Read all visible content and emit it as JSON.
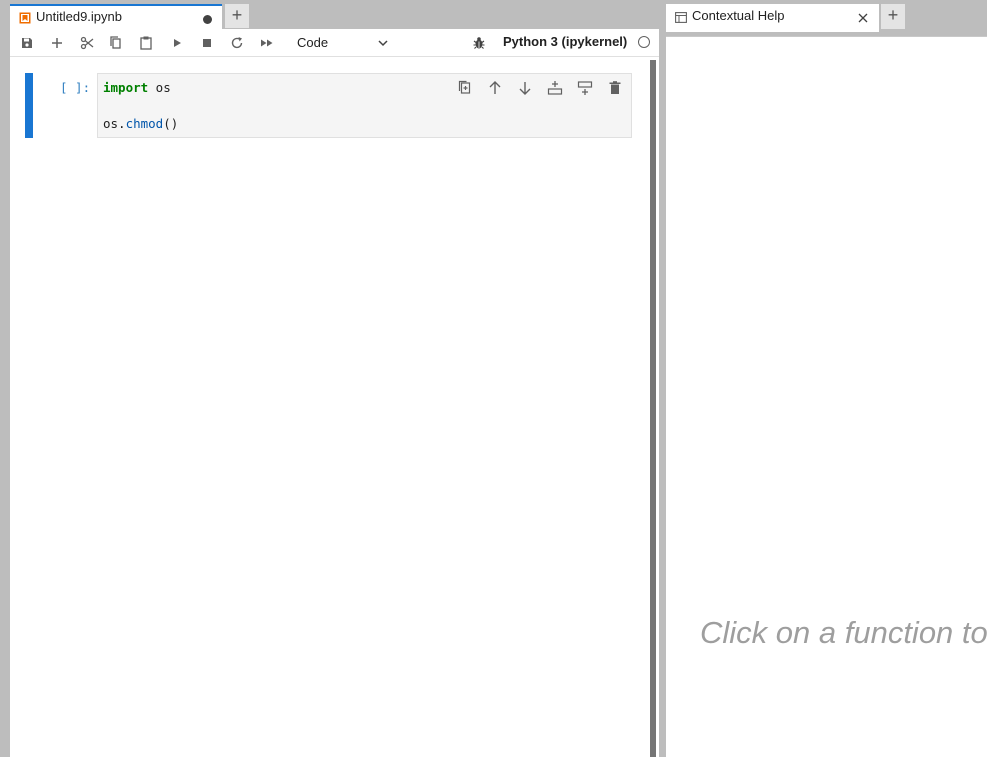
{
  "notebook_tab": {
    "title": "Untitled9.ipynb",
    "unsaved_indicator": "●"
  },
  "new_tab_label": "+",
  "toolbar": {
    "buttons": [
      "save-icon",
      "add-cell-icon",
      "cut-icon",
      "copy-icon",
      "paste-icon",
      "run-icon",
      "stop-icon",
      "restart-icon",
      "fast-forward-icon"
    ],
    "cell_type": "Code",
    "kernel_name": "Python 3 (ipykernel)"
  },
  "cell": {
    "prompt": "[ ]:",
    "code": {
      "line1_keyword": "import",
      "line1_rest": " os",
      "line3_obj": "os.",
      "line3_fn": "chmod",
      "line3_rest": "()"
    },
    "tools": [
      "duplicate-icon",
      "move-up-icon",
      "move-down-icon",
      "insert-above-icon",
      "insert-below-icon",
      "delete-icon"
    ]
  },
  "help_panel": {
    "tab_title": "Contextual Help",
    "message": "Click on a function to"
  },
  "colors": {
    "accent": "#1976d2",
    "prompt": "#307fc1",
    "keyword": "#008000",
    "function": "#0055aa",
    "placeholder": "#9e9e9e"
  }
}
